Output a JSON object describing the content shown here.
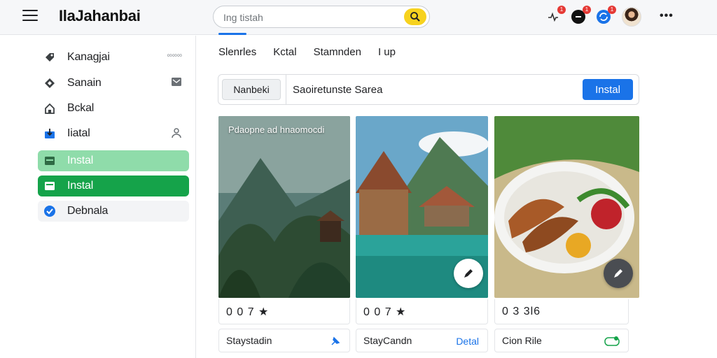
{
  "app": {
    "title": "IlaJahanbai"
  },
  "search": {
    "placeholder": "Ing tistah"
  },
  "header": {
    "notif_badges": [
      "1",
      "1",
      "1"
    ]
  },
  "sidebar": {
    "items": [
      {
        "label": "Kanagjai",
        "trail": "∞∞∞",
        "icon": "tag-icon"
      },
      {
        "label": "Sanain",
        "icon": "inbox-icon"
      },
      {
        "label": "Bckal",
        "icon": "home-icon"
      },
      {
        "label": "Iiatal",
        "icon": "download-icon"
      },
      {
        "label": "Instal",
        "icon": "folder-icon"
      },
      {
        "label": "Instal",
        "icon": "mail-icon"
      },
      {
        "label": "Debnala",
        "icon": "check-circle-icon"
      }
    ]
  },
  "main": {
    "tabs": [
      "Slenrles",
      "Kctal",
      "Stamnden",
      "I up"
    ],
    "filter": {
      "label": "Nanbeki",
      "value": "Saoiretunste Sarea",
      "button": "Instal"
    },
    "cards": [
      {
        "caption": "Pdaopne ad hnaomocdi",
        "rating": "0 0 7 ★",
        "title": "Staystadin",
        "action_icon": "pin-icon"
      },
      {
        "caption": "",
        "rating": "0 0 7 ★",
        "title": "StayCandn",
        "action": "Detal",
        "fab_icon": "edit-icon"
      },
      {
        "caption": "",
        "rating": "0 3 3l6",
        "title": "Cion Rile",
        "action_icon": "eco-badge-icon",
        "fab_icon": "edit-icon"
      }
    ]
  },
  "colors": {
    "accent": "#1a73e8",
    "highlight": "#f7d21e",
    "nav_active": "#15a34a",
    "nav_soft": "#8fdcaa"
  }
}
